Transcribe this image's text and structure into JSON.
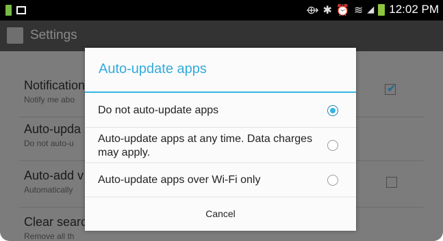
{
  "status_bar": {
    "time": "12:02 PM",
    "icons": [
      "battery-icon-small",
      "image-icon",
      "nfc-icon",
      "bluetooth-icon",
      "alarm-icon",
      "wifi-icon",
      "signal-icon",
      "battery-icon"
    ]
  },
  "action_bar": {
    "title": "Settings",
    "icon": "store-icon"
  },
  "settings": {
    "items": [
      {
        "title": "Notification",
        "subtitle": "Notify me abo",
        "checked": true
      },
      {
        "title": "Auto-upda",
        "subtitle": "Do not auto-u"
      },
      {
        "title": "Auto-add v",
        "subtitle": "Automatically",
        "checked": false
      },
      {
        "title": "Clear searc",
        "subtitle": "Remove all th"
      }
    ]
  },
  "dialog": {
    "title": "Auto-update apps",
    "options": [
      {
        "label": "Do not auto-update apps",
        "selected": true
      },
      {
        "label": "Auto-update apps at any time. Data charges may apply.",
        "selected": false
      },
      {
        "label": "Auto-update apps over Wi-Fi only",
        "selected": false
      }
    ],
    "cancel_label": "Cancel"
  },
  "colors": {
    "accent": "#33b5e5",
    "status_bar": "#000000",
    "action_bar": "#333333",
    "dim": "#7c7c7c"
  }
}
